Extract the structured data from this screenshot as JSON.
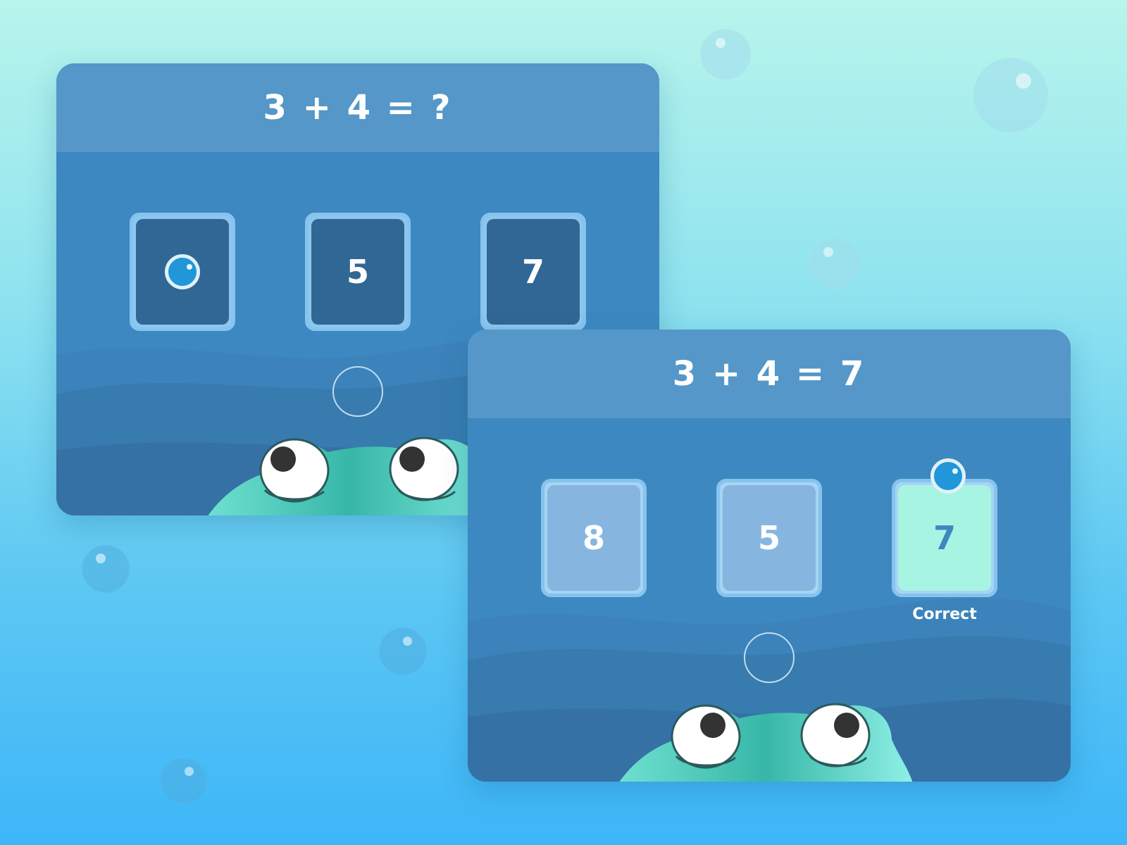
{
  "colors": {
    "card_body": "#3d88c0",
    "card_header": "#5497c8",
    "tile_dark": "#316794",
    "tile_light": "#86b6e0",
    "tile_correct": "#a8f4e3",
    "ball": "#2196d8",
    "frog": "#4fcabc"
  },
  "screen_question": {
    "equation": "3 + 4 = ?",
    "tiles": [
      {
        "value": "",
        "has_ball": true,
        "icon": "ball-icon"
      },
      {
        "value": "5",
        "has_ball": false
      },
      {
        "value": "7",
        "has_ball": false
      }
    ],
    "target_icon": "target-ring-icon",
    "mascot_icon": "frog-icon"
  },
  "screen_answer": {
    "equation": "3 + 4 = 7",
    "tiles": [
      {
        "value": "8",
        "state": "faded"
      },
      {
        "value": "5",
        "state": "faded"
      },
      {
        "value": "7",
        "state": "correct",
        "has_ball": true,
        "icon": "ball-icon"
      }
    ],
    "feedback_label": "Correct",
    "target_icon": "target-ring-icon",
    "mascot_icon": "frog-icon"
  }
}
